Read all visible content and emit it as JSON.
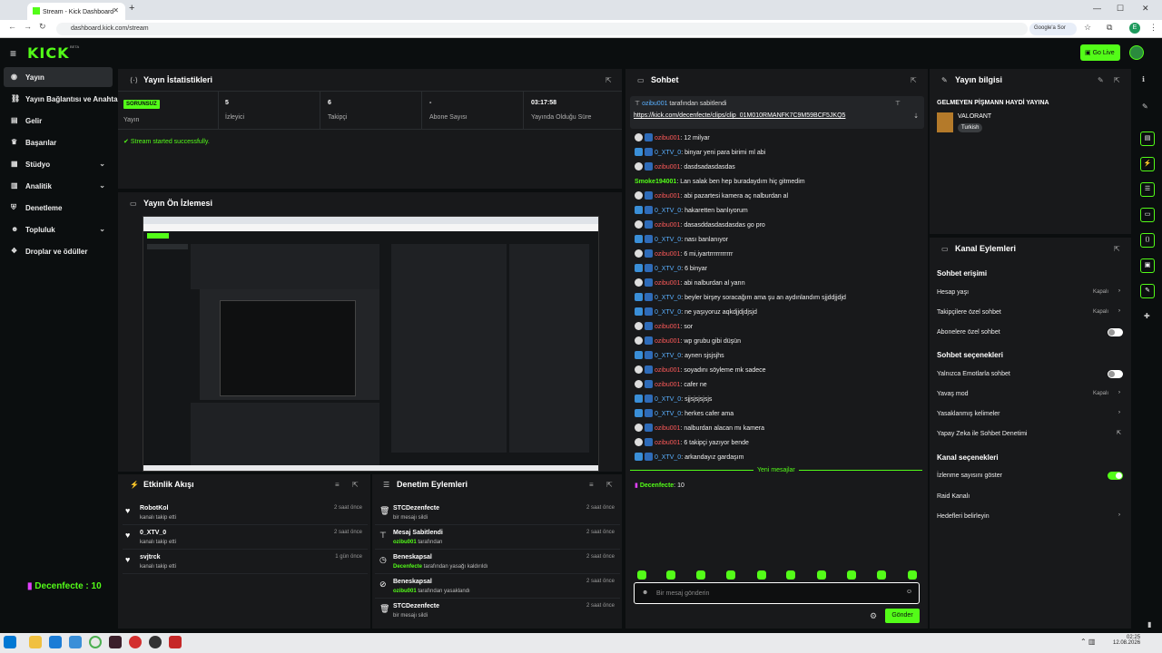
{
  "browser": {
    "tab_title": "Stream - Kick Dashboard",
    "url": "dashboard.kick.com/stream",
    "search_chip": "Google'a Sor",
    "profile_letter": "E"
  },
  "header": {
    "logo": "KICK",
    "beta": "BETA",
    "go_live": "Go Live"
  },
  "sidebar": {
    "items": [
      {
        "label": "Yayın",
        "icon": "broadcast-icon"
      },
      {
        "label": "Yayın Bağlantısı ve Anahtar",
        "icon": "link-icon"
      },
      {
        "label": "Gelir",
        "icon": "money-icon"
      },
      {
        "label": "Başarılar",
        "icon": "trophy-icon"
      },
      {
        "label": "Stüdyo",
        "icon": "studio-icon"
      },
      {
        "label": "Analitik",
        "icon": "analytics-icon"
      },
      {
        "label": "Denetleme",
        "icon": "shield-icon"
      },
      {
        "label": "Topluluk",
        "icon": "community-icon"
      },
      {
        "label": "Droplar ve ödüller",
        "icon": "gift-icon"
      }
    ],
    "bottom": "Decenfecte : 10"
  },
  "stats": {
    "title": "Yayın İstatistikleri",
    "items": [
      {
        "value": "SORUNSUZ",
        "label": "Yayın"
      },
      {
        "value": "5",
        "label": "İzleyici"
      },
      {
        "value": "6",
        "label": "Takipçi"
      },
      {
        "value": "-",
        "label": "Abone Sayısı"
      },
      {
        "value": "03:17:58",
        "label": "Yayında Olduğu Süre"
      }
    ],
    "status": "Stream started successfully."
  },
  "preview": {
    "title": "Yayın Ön İzlemesi"
  },
  "activity": {
    "title": "Etkinlik Akışı",
    "items": [
      {
        "name": "RobotKol",
        "sub": "kanalı takip etti",
        "time": "2 saat önce"
      },
      {
        "name": "0_XTV_0",
        "sub": "kanalı takip etti",
        "time": "2 saat önce"
      },
      {
        "name": "svjtrck",
        "sub": "kanalı takip etti",
        "time": "1 gün önce"
      }
    ]
  },
  "moderation": {
    "title": "Denetim Eylemleri",
    "items": [
      {
        "name": "STCDezenfecte",
        "user": "",
        "sub": "bir mesajı sildi",
        "time": "2 saat önce",
        "icon": "trash-icon"
      },
      {
        "name": "Mesaj Sabitlendi",
        "user": "ozibu001",
        "sub": " tarafından",
        "time": "2 saat önce",
        "icon": "pin-icon"
      },
      {
        "name": "Beneskapsal",
        "user": "Decenfecte",
        "sub": " tarafından yasağı kaldırıldı",
        "time": "2 saat önce",
        "icon": "clock-icon"
      },
      {
        "name": "Beneskapsal",
        "user": "ozibu001",
        "sub": " tarafından yasaklandı",
        "time": "2 saat önce",
        "icon": "ban-icon"
      },
      {
        "name": "STCDezenfecte",
        "user": "",
        "sub": "bir mesajı sildi",
        "time": "2 saat önce",
        "icon": "trash-icon"
      }
    ]
  },
  "chat": {
    "title": "Sohbet",
    "pinned_user": "ozibu001",
    "pinned_by": " tarafından sabitlendi",
    "pinned_link": "https://kick.com/decenfecte/clips/clip_01M010RMANFK7C9M59BCF5JKQ5",
    "messages": [
      {
        "user": "ozibu001",
        "c": "u1",
        "text": "12 milyar"
      },
      {
        "user": "0_XTV_0",
        "c": "u2",
        "text": "binyar yeni para birimi ml abi"
      },
      {
        "user": "ozibu001",
        "c": "u1",
        "text": "dasdsadasdasdas"
      },
      {
        "user": "Smoke194001",
        "c": "u3",
        "text": "Lan salak ben hep buradaydım hiç gitmedim"
      },
      {
        "user": "ozibu001",
        "c": "u1",
        "text": "abi pazartesi kamera aç nalburdan al"
      },
      {
        "user": "0_XTV_0",
        "c": "u2",
        "text": "hakaretten banlıyorum"
      },
      {
        "user": "ozibu001",
        "c": "u1",
        "text": "dasasddasdasdasdas go pro"
      },
      {
        "user": "0_XTV_0",
        "c": "u2",
        "text": "nası banlanıyor"
      },
      {
        "user": "ozibu001",
        "c": "u1",
        "text": "6 mi,iyartrrrrrrrrrrr"
      },
      {
        "user": "0_XTV_0",
        "c": "u2",
        "text": "6 binyar"
      },
      {
        "user": "ozibu001",
        "c": "u1",
        "text": "abi nalburdan al yarın"
      },
      {
        "user": "0_XTV_0",
        "c": "u2",
        "text": "beyler birşey soracağım ama şu an aydınlandım sjjddjjdjd"
      },
      {
        "user": "0_XTV_0",
        "c": "u2",
        "text": "ne yaşıyoruz aqkdjjdjdjsjd"
      },
      {
        "user": "ozibu001",
        "c": "u1",
        "text": "sor"
      },
      {
        "user": "ozibu001",
        "c": "u1",
        "text": "wp grubu gibi düşün"
      },
      {
        "user": "0_XTV_0",
        "c": "u2",
        "text": "aynen sjsjsjhs"
      },
      {
        "user": "ozibu001",
        "c": "u1",
        "text": "soyadını söyleme mk sadece"
      },
      {
        "user": "ozibu001",
        "c": "u1",
        "text": "cafer ne"
      },
      {
        "user": "0_XTV_0",
        "c": "u2",
        "text": "sjjsjsjsjsjs"
      },
      {
        "user": "0_XTV_0",
        "c": "u2",
        "text": "herkes cafer ama"
      },
      {
        "user": "ozibu001",
        "c": "u1",
        "text": "nalburdan alacan mı kamera"
      },
      {
        "user": "ozibu001",
        "c": "u1",
        "text": "6 takipçi yazıyor bende"
      },
      {
        "user": "0_XTV_0",
        "c": "u2",
        "text": "arkandayız gardaşım"
      }
    ],
    "new_messages": "Yeni mesajlar",
    "last": {
      "user": "Decenfecte",
      "text": "10"
    },
    "placeholder": "Bir mesaj gönderin",
    "send": "Gönder"
  },
  "stream_info": {
    "title": "Yayın bilgisi",
    "stream_title": "GELMEYEN PİŞMANN HAYDİ YAYINA",
    "game": "VALORANT",
    "tag": "Turkish"
  },
  "channel_actions": {
    "title": "Kanal Eylemleri",
    "sec1": "Sohbet erişimi",
    "hesap": "Hesap yaşı",
    "hesap_val": "Kapalı",
    "takip": "Takipçilere özel sohbet",
    "takip_val": "Kapalı",
    "abone": "Abonelere özel sohbet",
    "sec2": "Sohbet seçenekleri",
    "emote": "Yalnızca Emotlarla sohbet",
    "yavas": "Yavaş mod",
    "yavas_val": "Kapalı",
    "yasak": "Yasaklanmış kelimeler",
    "yapay": "Yapay Zeka ile Sohbet Denetimi",
    "sec3": "Kanal seçenekleri",
    "izlenme": "İzlenme sayısını göster",
    "raid": "Raid Kanalı",
    "hedef": "Hedefleri belirleyin"
  },
  "taskbar": {
    "time": "02:25",
    "date": "12.08.2026"
  },
  "colors": {
    "accent": "#53fc18",
    "panel": "#18191b",
    "bg": "#0b0e0f"
  }
}
